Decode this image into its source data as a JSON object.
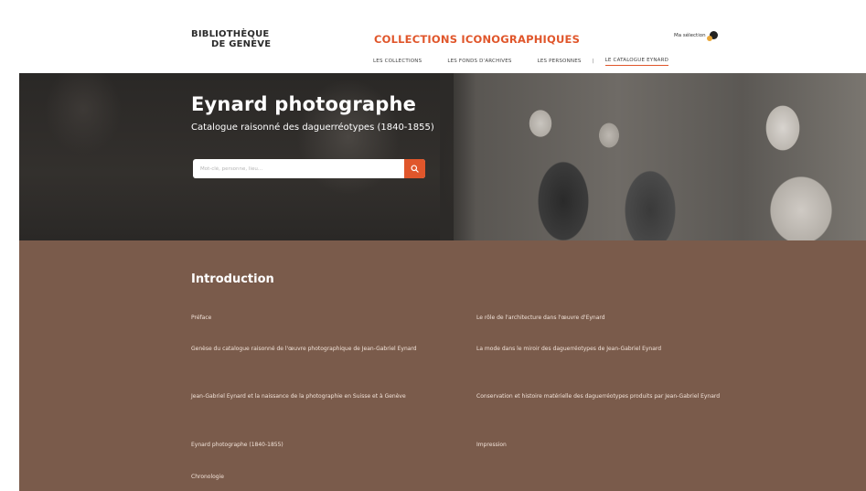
{
  "header": {
    "logo_line1": "BIBLIOTHÈQUE",
    "logo_line2": "DE GENÈVE",
    "site_title": "COLLECTIONS ICONOGRAPHIQUES",
    "nav": [
      "LES COLLECTIONS",
      "LES FONDS D'ARCHIVES",
      "LES PERSONNES",
      "|",
      "LE CATALOGUE EYNARD"
    ],
    "selection_label": "Ma sélection",
    "selection_icon": "selection-badge-icon"
  },
  "hero": {
    "title": "Eynard photographe",
    "subtitle": "Catalogue raisonné des daguerréotypes (1840-1855)",
    "search_placeholder": "Mot-clé, personne, lieu...",
    "search_icon": "search-icon"
  },
  "intro": {
    "title": "Introduction",
    "left_links": [
      "Préface",
      "Genèse du catalogue raisonné de l'œuvre photographique de Jean-Gabriel Eynard",
      "Jean-Gabriel Eynard et la naissance de la photographie en Suisse et à Genève",
      "Eynard photographe (1840-1855)",
      "Chronologie"
    ],
    "right_links": [
      "Le rôle de l'architecture dans l'œuvre d'Eynard",
      "La mode dans le miroir des daguerréotypes de Jean-Gabriel Eynard",
      "Conservation et histoire matérielle des daguerréotypes produits par Jean-Gabriel Eynard",
      "Impression"
    ]
  },
  "colors": {
    "accent": "#e0562b",
    "intro_bg": "#7a5b4b",
    "hero_bg": "#2c2a28"
  }
}
